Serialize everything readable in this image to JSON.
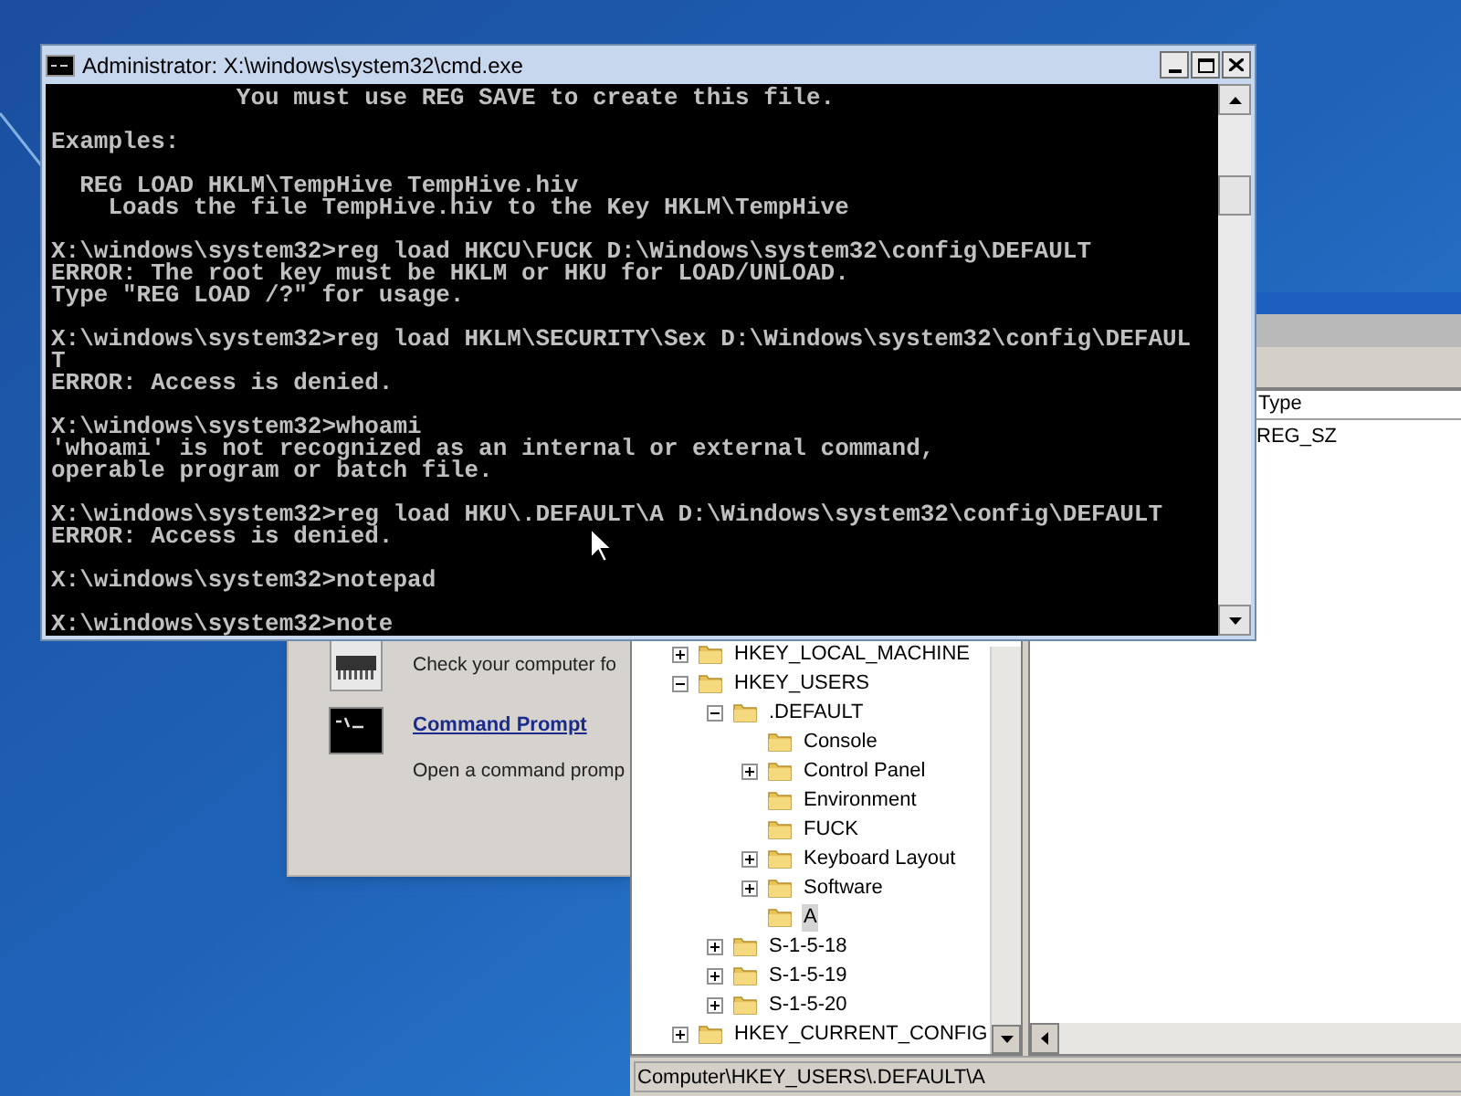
{
  "cmd_window": {
    "title": "Administrator: X:\\windows\\system32\\cmd.exe",
    "console_blocks": [
      [
        "             You must use REG SAVE to create this file."
      ],
      [
        "Examples:"
      ],
      [
        "  REG LOAD HKLM\\TempHive TempHive.hiv",
        "    Loads the file TempHive.hiv to the Key HKLM\\TempHive"
      ],
      [
        "X:\\windows\\system32>reg load HKCU\\FUCK D:\\Windows\\system32\\config\\DEFAULT",
        "ERROR: The root key must be HKLM or HKU for LOAD/UNLOAD.",
        "Type \"REG LOAD /?\" for usage."
      ],
      [
        "X:\\windows\\system32>reg load HKLM\\SECURITY\\Sex D:\\Windows\\system32\\config\\DEFAUL",
        "T",
        "ERROR: Access is denied."
      ],
      [
        "X:\\windows\\system32>whoami",
        "'whoami' is not recognized as an internal or external command,",
        "operable program or batch file."
      ],
      [
        "X:\\windows\\system32>reg load HKU\\.DEFAULT\\A D:\\Windows\\system32\\config\\DEFAULT",
        "ERROR: Access is denied."
      ],
      [
        "X:\\windows\\system32>notepad"
      ],
      [
        "X:\\windows\\system32>note"
      ]
    ]
  },
  "recovery_window": {
    "items": [
      {
        "kind": "memory",
        "description": "Check your computer fo"
      },
      {
        "kind": "console",
        "link": "Command Prompt",
        "description": "Open a command promp"
      }
    ]
  },
  "regedit": {
    "tree": [
      {
        "label": "HKEY_LOCAL_MACHINE",
        "expanded": false,
        "selected": false
      },
      {
        "label": "HKEY_USERS",
        "expanded": true,
        "selected": false,
        "children": [
          {
            "label": ".DEFAULT",
            "expanded": true,
            "selected": false,
            "children": [
              {
                "label": "Console",
                "selected": false
              },
              {
                "label": "Control Panel",
                "expanded": false,
                "selected": false
              },
              {
                "label": "Environment",
                "selected": false
              },
              {
                "label": "FUCK",
                "selected": false
              },
              {
                "label": "Keyboard Layout",
                "expanded": false,
                "selected": false
              },
              {
                "label": "Software",
                "expanded": false,
                "selected": false
              },
              {
                "label": "A",
                "selected": true
              }
            ]
          },
          {
            "label": "S-1-5-18",
            "expanded": false,
            "selected": false
          },
          {
            "label": "S-1-5-19",
            "expanded": false,
            "selected": false
          },
          {
            "label": "S-1-5-20",
            "expanded": false,
            "selected": false
          }
        ]
      },
      {
        "label": "HKEY_CURRENT_CONFIG",
        "expanded": false,
        "selected": false
      }
    ],
    "columns": [
      "Type"
    ],
    "rows": [
      [
        "REG_SZ"
      ]
    ],
    "status_bar": "Computer\\HKEY_USERS\\.DEFAULT\\A"
  }
}
